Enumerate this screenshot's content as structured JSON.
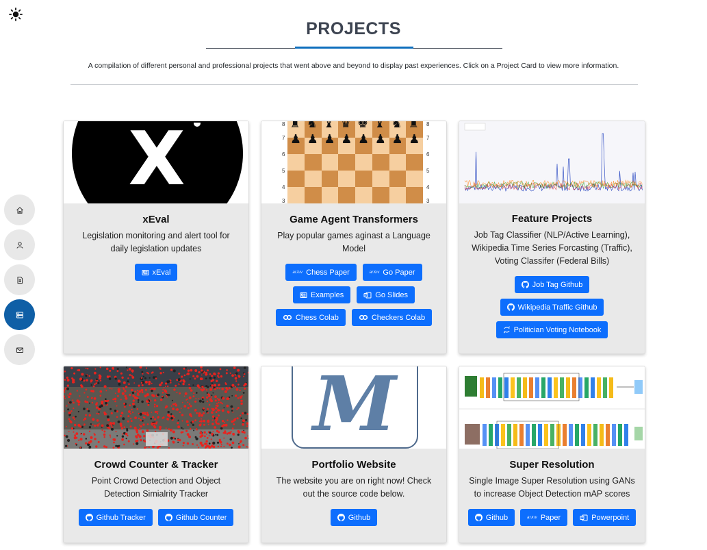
{
  "header": {
    "title": "PROJECTS",
    "subtitle": "A compilation of different personal and professional projects that went above and beyond to display past experiences. Click on a Project Card to view more information."
  },
  "icons": {
    "theme": "sun-icon",
    "nav": [
      "home-icon",
      "user-icon",
      "document-icon",
      "server-icon",
      "mail-icon"
    ]
  },
  "colors": {
    "accent": "#0d6efd",
    "nav_active": "#0f5fa6",
    "card_bg": "#e9e9e9",
    "title": "#3d4451"
  },
  "cards": [
    {
      "title": "xEval",
      "description": "Legislation monitoring and alert tool for daily legislation updates",
      "buttons": [
        {
          "label": "xEval",
          "icon": "newspaper-icon"
        }
      ]
    },
    {
      "title": "Game Agent Transformers",
      "description": "Play popular games aginast a Language Model",
      "buttons": [
        {
          "label": "Chess Paper",
          "icon": "arxiv-icon"
        },
        {
          "label": "Go Paper",
          "icon": "arxiv-icon"
        },
        {
          "label": "Examples",
          "icon": "newspaper-icon"
        },
        {
          "label": "Go Slides",
          "icon": "slides-icon"
        },
        {
          "label": "Chess Colab",
          "icon": "colab-icon"
        },
        {
          "label": "Checkers Colab",
          "icon": "colab-icon"
        }
      ]
    },
    {
      "title": "Feature Projects",
      "description": "Job Tag Classifier (NLP/Active Learning), Wikipedia Time Series Forcasting (Traffic), Voting Classifer (Federal Bills)",
      "buttons": [
        {
          "label": "Job Tag Github",
          "icon": "github-icon"
        },
        {
          "label": "Wikipedia Traffic Github",
          "icon": "github-icon"
        },
        {
          "label": "Politician Voting Notebook",
          "icon": "jupyter-icon"
        }
      ]
    },
    {
      "title": "Crowd Counter & Tracker",
      "description": "Point Crowd Detection and Object Detection Simialrity Tracker",
      "buttons": [
        {
          "label": "Github Tracker",
          "icon": "github-icon"
        },
        {
          "label": "Github Counter",
          "icon": "github-icon"
        }
      ]
    },
    {
      "title": "Portfolio Website",
      "description": "The website you are on right now! Check out the source code below.",
      "buttons": [
        {
          "label": "Github",
          "icon": "github-icon"
        }
      ]
    },
    {
      "title": "Super Resolution",
      "description": "Single Image Super Resolution using GANs to increase Object Detection mAP scores",
      "buttons": [
        {
          "label": "Github",
          "icon": "github-icon"
        },
        {
          "label": "Paper",
          "icon": "arxiv-icon"
        },
        {
          "label": "Powerpoint",
          "icon": "slides-icon"
        }
      ]
    }
  ],
  "chess": {
    "ranks": [
      "8",
      "7",
      "6",
      "5",
      "4",
      "3"
    ]
  }
}
